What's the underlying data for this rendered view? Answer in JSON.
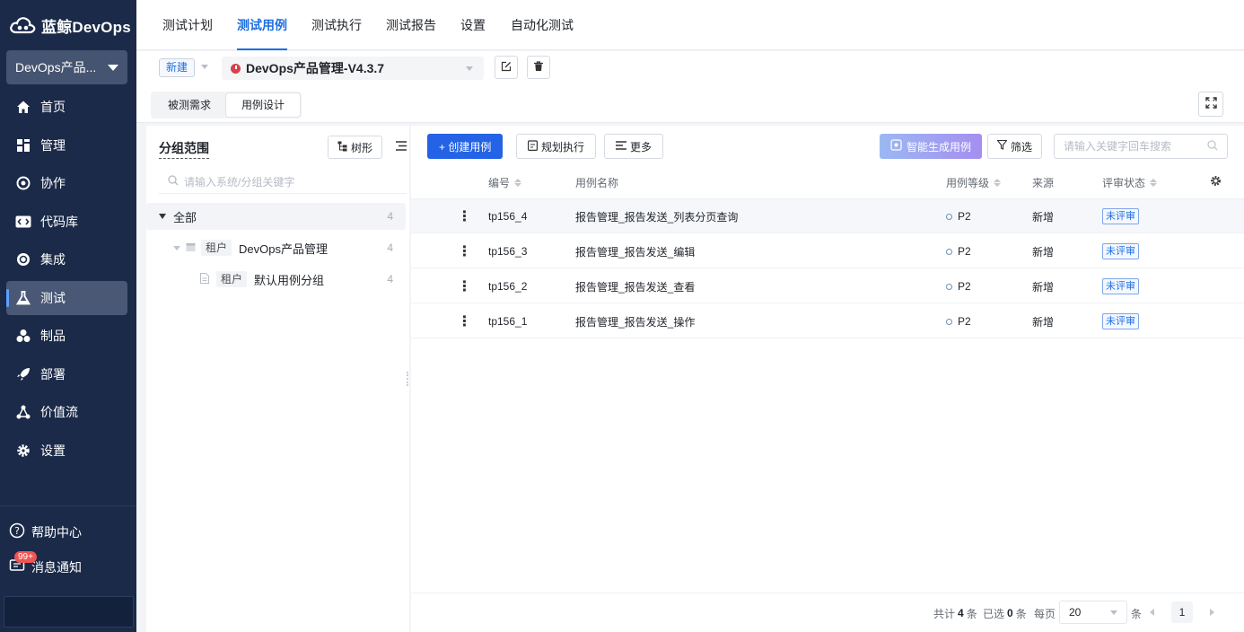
{
  "brand": {
    "name": "蓝鲸DevOps"
  },
  "project": {
    "name": "DevOps产品..."
  },
  "nav": [
    {
      "label": "首页",
      "icon": "home-icon"
    },
    {
      "label": "管理",
      "icon": "grid-icon"
    },
    {
      "label": "协作",
      "icon": "collab-icon"
    },
    {
      "label": "代码库",
      "icon": "code-icon"
    },
    {
      "label": "集成",
      "icon": "integration-icon"
    },
    {
      "label": "测试",
      "icon": "flask-icon",
      "active": true
    },
    {
      "label": "制品",
      "icon": "artifact-icon"
    },
    {
      "label": "部署",
      "icon": "rocket-icon"
    },
    {
      "label": "价值流",
      "icon": "flow-icon"
    },
    {
      "label": "设置",
      "icon": "gear-icon"
    }
  ],
  "help": {
    "label": "帮助中心"
  },
  "messages": {
    "label": "消息通知",
    "badge": "99+"
  },
  "tabs": [
    {
      "label": "测试计划"
    },
    {
      "label": "测试用例",
      "active": true
    },
    {
      "label": "测试执行"
    },
    {
      "label": "测试报告"
    },
    {
      "label": "设置"
    },
    {
      "label": "自动化测试"
    }
  ],
  "subbar": {
    "new_label": "新建",
    "plan_name": "DevOps产品管理-V4.3.7",
    "segments": [
      {
        "label": "被测需求"
      },
      {
        "label": "用例设计",
        "active": true
      }
    ]
  },
  "left": {
    "title": "分组范围",
    "tree_button": "树形",
    "search_placeholder": "请输入系统/分组关键字",
    "tree": [
      {
        "label": "全部",
        "count": "4"
      },
      {
        "tag": "租户",
        "label": "DevOps产品管理",
        "count": "4"
      },
      {
        "tag": "租户",
        "label": "默认用例分组",
        "count": "4"
      }
    ]
  },
  "toolbar": {
    "create": "+ 创建用例",
    "plan_run": "规划执行",
    "more": "更多",
    "ai_generate": "智能生成用例",
    "filter": "筛选",
    "search_placeholder": "请输入关键字回车搜索"
  },
  "table": {
    "headers": {
      "id": "编号",
      "name": "用例名称",
      "level": "用例等级",
      "source": "来源",
      "review": "评审状态"
    },
    "rows": [
      {
        "id": "tp156_4",
        "name": "报告管理_报告发送_列表分页查询",
        "level": "P2",
        "source": "新增",
        "review": "未评审"
      },
      {
        "id": "tp156_3",
        "name": "报告管理_报告发送_编辑",
        "level": "P2",
        "source": "新增",
        "review": "未评审"
      },
      {
        "id": "tp156_2",
        "name": "报告管理_报告发送_查看",
        "level": "P2",
        "source": "新增",
        "review": "未评审"
      },
      {
        "id": "tp156_1",
        "name": "报告管理_报告发送_操作",
        "level": "P2",
        "source": "新增",
        "review": "未评审"
      }
    ]
  },
  "pager": {
    "total_prefix": "共计",
    "total": "4",
    "total_suffix": "条",
    "selected_prefix": "已选",
    "selected": "0",
    "selected_suffix": "条",
    "per_page_label": "每页",
    "per_page": "20",
    "per_page_suffix": "条",
    "current": "1"
  }
}
